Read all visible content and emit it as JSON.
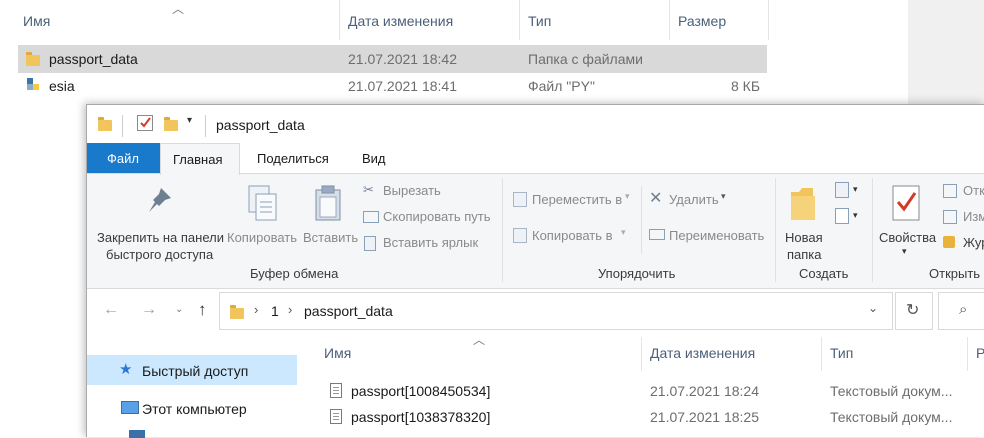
{
  "background_explorer": {
    "columns": {
      "name": "Имя",
      "date": "Дата изменения",
      "type": "Тип",
      "size": "Размер"
    },
    "rows": [
      {
        "name": "passport_data",
        "date": "21.07.2021 18:42",
        "type": "Папка с файлами",
        "size": ""
      },
      {
        "name": "esia",
        "date": "21.07.2021 18:41",
        "type": "Файл \"PY\"",
        "size": "8 КБ"
      }
    ]
  },
  "window": {
    "title": "passport_data",
    "tabs": {
      "file": "Файл",
      "home": "Главная",
      "share": "Поделиться",
      "view": "Вид"
    },
    "ribbon": {
      "clipboard": {
        "pin": "Закрепить на панели быстрого доступа",
        "pin_line1": "Закрепить на панели",
        "pin_line2": "быстрого доступа",
        "copy": "Копировать",
        "paste": "Вставить",
        "cut": "Вырезать",
        "copy_path": "Скопировать путь",
        "paste_shortcut": "Вставить ярлык",
        "group": "Буфер обмена"
      },
      "organize": {
        "move_to": "Переместить в",
        "copy_to": "Копировать в",
        "delete": "Удалить",
        "rename": "Переименовать",
        "group": "Упорядочить"
      },
      "new": {
        "new_folder_line1": "Новая",
        "new_folder_line2": "папка",
        "group": "Создать"
      },
      "open": {
        "properties": "Свойства",
        "open": "Отк",
        "edit": "Изм",
        "history": "Жур",
        "group": "Открыть"
      }
    },
    "address": {
      "crumb1": "1",
      "crumb2": "passport_data"
    },
    "nav_pane": {
      "quick_access": "Быстрый доступ",
      "this_pc": "Этот компьютер"
    },
    "list": {
      "columns": {
        "name": "Имя",
        "date": "Дата изменения",
        "type": "Тип",
        "size": "Р"
      },
      "rows": [
        {
          "name": "passport[1008450534]",
          "date": "21.07.2021 18:24",
          "type": "Текстовый докум..."
        },
        {
          "name": "passport[1038378320]",
          "date": "21.07.2021 18:25",
          "type": "Текстовый докум..."
        }
      ]
    }
  },
  "colors": {
    "file_tab": "#1979ca",
    "selection": "#cce8ff",
    "row_selected": "#d9d9d9"
  }
}
